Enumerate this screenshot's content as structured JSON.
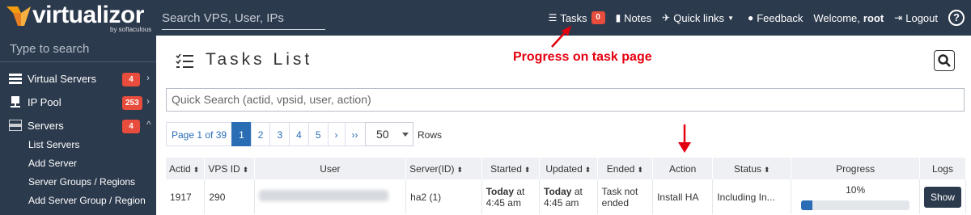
{
  "app": {
    "name": "virtualizor",
    "by": "by softaculous",
    "brand_color": "#f39c12",
    "header_bg": "#2c3a4d"
  },
  "top_search": {
    "placeholder": "Search VPS, User, IPs"
  },
  "top_nav": {
    "tasks_label": "Tasks",
    "tasks_count": "0",
    "notes_label": "Notes",
    "quick_links_label": "Quick links",
    "feedback_label": "Feedback",
    "welcome_prefix": "Welcome,",
    "welcome_user": "root",
    "logout_label": "Logout",
    "help_label": "?"
  },
  "sidebar": {
    "search_placeholder": "Type to search",
    "items": [
      {
        "label": "Virtual Servers",
        "badge": "4",
        "chevron": "›"
      },
      {
        "label": "IP Pool",
        "badge": "253",
        "chevron": "›"
      },
      {
        "label": "Servers",
        "badge": "4",
        "chevron": "^"
      }
    ],
    "sub_items": [
      "List Servers",
      "Add Server",
      "Server Groups / Regions",
      "Add Server Group / Region"
    ]
  },
  "page": {
    "title": "Tasks List"
  },
  "annotations": {
    "progress_note": "Progress on task page",
    "color": "#e3000f"
  },
  "quick_search": {
    "placeholder": "Quick Search (actid, vpsid, user, action)"
  },
  "pagination": {
    "info": "Page 1 of 39",
    "pages": [
      "1",
      "2",
      "3",
      "4",
      "5"
    ],
    "next": "›",
    "last": "››",
    "rows_value": "50",
    "rows_label": "Rows"
  },
  "table": {
    "headers": [
      "Actid",
      "VPS ID",
      "User",
      "Server(ID)",
      "Started",
      "Updated",
      "Ended",
      "Action",
      "Status",
      "Progress",
      "Logs"
    ],
    "rows": [
      {
        "actid": "1917",
        "vpsid": "290",
        "server": "ha2 (1)",
        "started_bold": "Today",
        "started_rest": "at 4:45 am",
        "updated_bold": "Today",
        "updated_rest": "at 4:45 am",
        "ended": "Task not ended",
        "action": "Install HA",
        "status": "Including In...",
        "progress_text": "10%",
        "progress": 0.1,
        "logs_button": "Show"
      }
    ]
  }
}
